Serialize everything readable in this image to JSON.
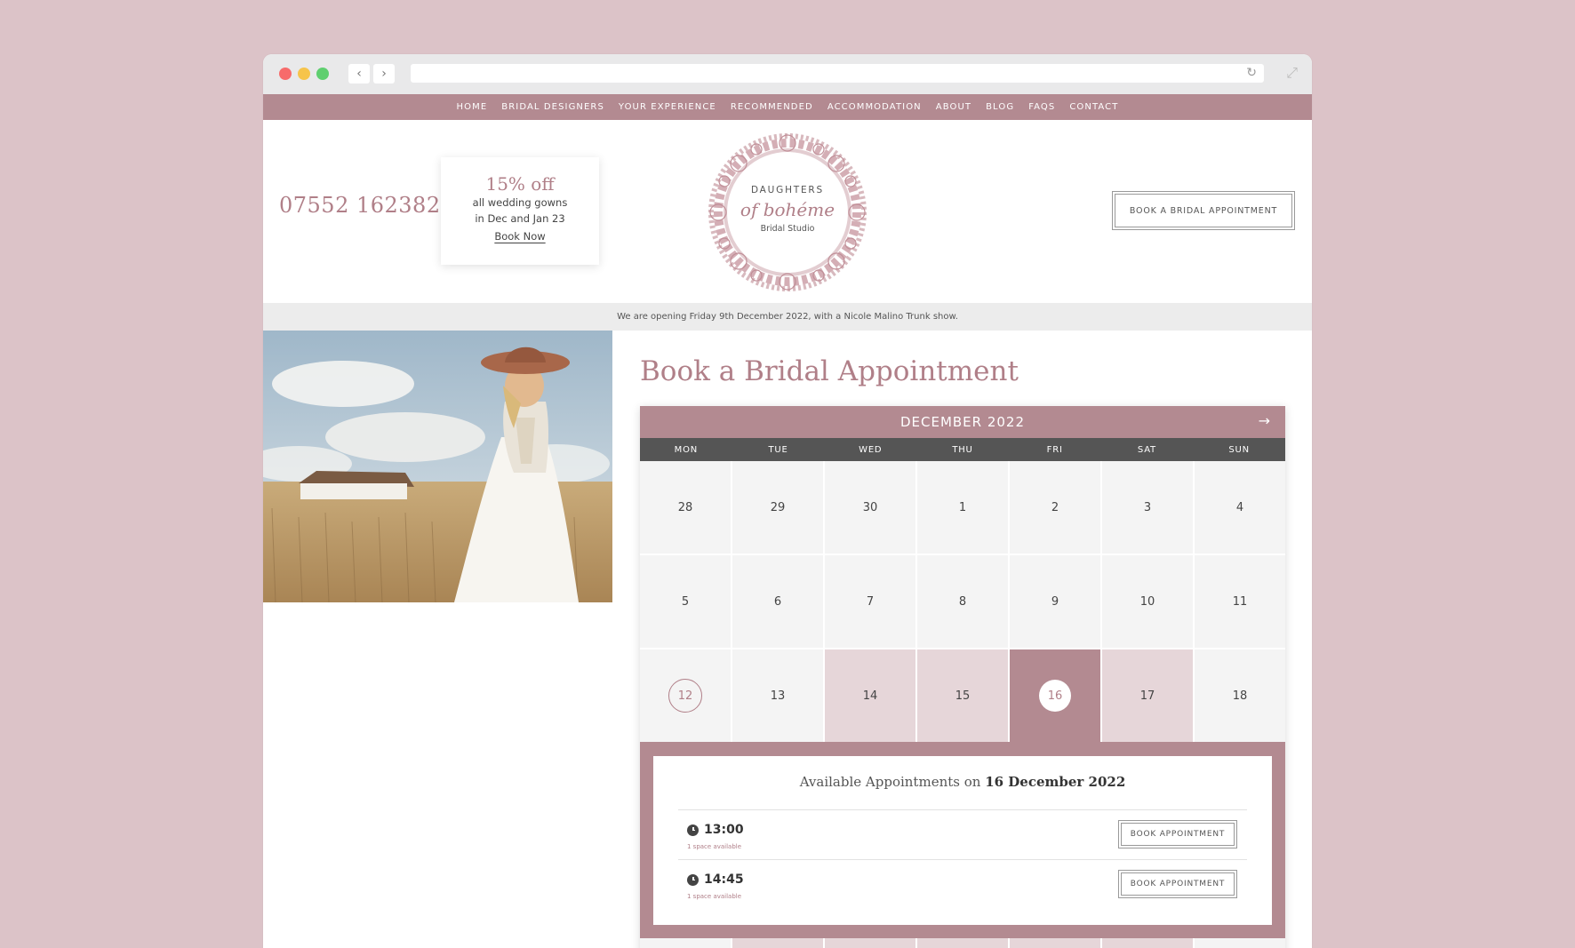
{
  "nav": {
    "items": [
      "HOME",
      "BRIDAL DESIGNERS",
      "YOUR EXPERIENCE",
      "RECOMMENDED",
      "ACCOMMODATION",
      "ABOUT",
      "BLOG",
      "FAQS",
      "CONTACT"
    ]
  },
  "header": {
    "phone": "07552 162382",
    "promo": {
      "title": "15% off",
      "line1": "all wedding gowns",
      "line2": "in Dec and Jan 23",
      "link": "Book Now"
    },
    "logo": {
      "line1": "DAUGHTERS",
      "line2": "of bohéme",
      "line3": "Bridal Studio"
    },
    "book_button": "BOOK A BRIDAL APPOINTMENT"
  },
  "banner": "We are opening Friday 9th December 2022, with a Nicole Malino Trunk show.",
  "booking": {
    "title": "Book a Bridal Appointment",
    "month": "DECEMBER 2022",
    "weekdays": [
      "MON",
      "TUE",
      "WED",
      "THU",
      "FRI",
      "SAT",
      "SUN"
    ],
    "weeks": [
      [
        "28",
        "29",
        "30",
        "1",
        "2",
        "3",
        "4"
      ],
      [
        "5",
        "6",
        "7",
        "8",
        "9",
        "10",
        "11"
      ],
      [
        "12",
        "13",
        "14",
        "15",
        "16",
        "17",
        "18"
      ]
    ],
    "appointments": {
      "title_prefix": "Available Appointments on",
      "date": "16 December 2022",
      "slots": [
        {
          "time": "13:00",
          "space": "1 space available",
          "button": "BOOK APPOINTMENT"
        },
        {
          "time": "14:45",
          "space": "1 space available",
          "button": "BOOK APPOINTMENT"
        }
      ]
    }
  },
  "colors": {
    "accent": "#b38a91",
    "accent_text": "#b07f88",
    "available_day": "#e6d6d9",
    "page_bg": "#dcc3c8"
  }
}
